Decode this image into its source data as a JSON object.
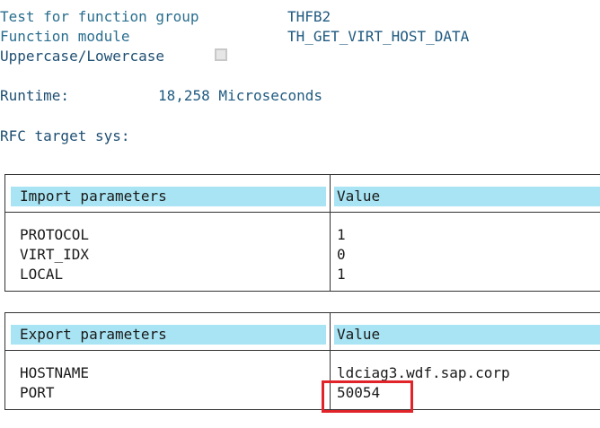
{
  "header": {
    "function_group_label": "Test for function group",
    "function_group_value": "THFB2",
    "function_module_label": "Function module",
    "function_module_value": "TH_GET_VIRT_HOST_DATA",
    "case_label": "Uppercase/Lowercase",
    "case_checked": false
  },
  "runtime": {
    "label": "Runtime:",
    "value": "18,258 Microseconds"
  },
  "rfc": {
    "label": "RFC target sys:"
  },
  "import_table": {
    "col1_header": "Import parameters",
    "col2_header": "Value",
    "rows": [
      {
        "name": "PROTOCOL",
        "value": "1"
      },
      {
        "name": "VIRT_IDX",
        "value": "0"
      },
      {
        "name": "LOCAL",
        "value": "1"
      }
    ]
  },
  "export_table": {
    "col1_header": "Export parameters",
    "col2_header": "Value",
    "rows": [
      {
        "name": "HOSTNAME",
        "value": "ldciag3.wdf.sap.corp"
      },
      {
        "name": "PORT",
        "value": "50054"
      }
    ]
  },
  "colors": {
    "header_cell_bg": "#a8e4f3",
    "label_text": "#2a6e8f",
    "highlight_border": "#e0242a"
  }
}
